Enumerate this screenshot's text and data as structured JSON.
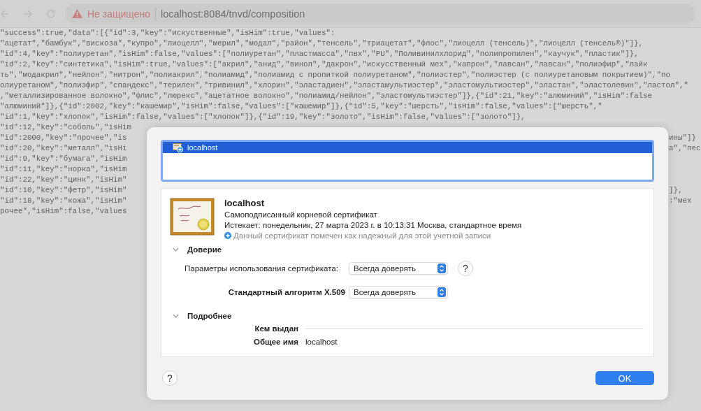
{
  "browser": {
    "security_label": "Не защищено",
    "url": "localhost:8084/tnvd/composition"
  },
  "page_lines": [
    {
      "text": "\"success\":true,\"data\":[{\"id\":3,\"key\":\"искуственные\",\"isHim\":true,\"values\":"
    },
    {
      "text": "\"ацетат\",\"бамбук\",\"вискоза\",\"купро\",\"лиоцелл\",\"мерил\",\"модал\",\"район\",\"тенсель\",\"триацетат\",\"флос\",\"лиоцелл (тенсель)\",\"лиоцелл (тенсель®)\"]},"
    },
    {
      "text": "\"id\":4,\"key\":\"полиуретан\",\"isHim\":false,\"values\":[\"полиуретан\",\"пластмасса\",\"пвх\",\"PU\",\"Поливинилхлорид\",\"полипропилен\",\"каучук\",\"пластик\"]},"
    },
    {
      "text": "\"id\":2,\"key\":\"синтетика\",\"isHim\":true,\"values\":[\"акрил\",\"анид\",\"винол\",\"дакрон\",\"искусственный мех\",\"капрон\",\"лавсан\",\"лавсан\",\"полиэфир\",\"лайк"
    },
    {
      "text": "ть\",\"модакрил\",\"нейлон\",\"нитрон\",\"полиакрил\",\"полиамид\",\"полиамид с пропиткой полиуретаном\",\"полиэстер\",\"полиэстер (с полиуретановым покрытием)\",\"по"
    },
    {
      "text": "олиуретаном\",\"полиэфир\",\"спандекс\",\"терилен\",\"тривинил\",\"хлорин\",\"эластадиен\",\"эластамультиэстер\",\"эластомультиэстер\",\"эластан\",\"эластолевин\",\"ластол\",\""
    },
    {
      "text": ",\"металлизированное волокно\",\"флис\",\"люрекс\",\"ацетатное волокно\",\"полиамид/нейлон\",\"эластомультиэстер\"]},{\"id\":21,\"key\":\"алюминий\",\"isHim\":false"
    },
    {
      "text": "\"алюминий\"]},{\"id\":2002,\"key\":\"кашемир\",\"isHim\":false,\"values\":[\"кашемир\"]},{\"id\":5,\"key\":\"шерсть\",\"isHim\":false,\"values\":[\"шерсть\",\""
    },
    {
      "text": "\"id\":1,\"key\":\"хлопок\",\"isHim\":false,\"values\":[\"хлопок\"]},{\"id\":19,\"key\":\"золото\",\"isHim\":false,\"values\":[\"золото\"]},"
    },
    {
      "text": "\"id\":12,\"key\":\"соболь\",\"isHim"
    },
    {
      "text": "\"id\":2000,\"key\":\"прочее\",\"is",
      "tail": "ины\"]}"
    },
    {
      "text": "\"id\":20,\"key\":\"металл\",\"isHi",
      "tail": "а\",\"пес"
    },
    {
      "text": "\"id\":9,\"key\":\"бумага\",\"isHim"
    },
    {
      "text": "\"id\":11,\"key\":\"норка\",\"isHim"
    },
    {
      "text": "\"id\":22,\"key\":\"цинк\",\"isHim\""
    },
    {
      "text": "\"id\":10,\"key\":\"фетр\",\"isHim\"",
      "tail": "]},"
    },
    {
      "text": "\"id\":18,\"key\":\"кожа\",\"isHim\"",
      "tail": ":\"мех"
    },
    {
      "text": "рочее\",\"isHim\":false,\"values"
    }
  ],
  "dialog": {
    "list": [
      {
        "label": "localhost",
        "selected": true
      }
    ],
    "certificate": {
      "name": "localhost",
      "type": "Самоподписанный корневой сертификат",
      "expires": "Истекает: понедельник, 27 марта 2023 г. в 10:13:31 Москва, стандартное время",
      "trust_status": "Данный сертификат помечен как надежный для этой учетной записи"
    },
    "trust": {
      "title": "Доверие",
      "expanded": true,
      "rows": [
        {
          "label": "Параметры использования сертификата:",
          "value": "Всегда доверять",
          "emphasized": false,
          "help": "?"
        },
        {
          "label": "Стандартный алгоритм X.509",
          "value": "Всегда доверять",
          "emphasized": true
        }
      ]
    },
    "details": {
      "title": "Подробнее",
      "expanded": true,
      "rows": [
        {
          "kind": "heading",
          "label": "Кем выдан"
        },
        {
          "kind": "field",
          "label": "Общее имя",
          "value": "localhost"
        }
      ]
    },
    "help_button": "?",
    "ok_button": "OK"
  }
}
